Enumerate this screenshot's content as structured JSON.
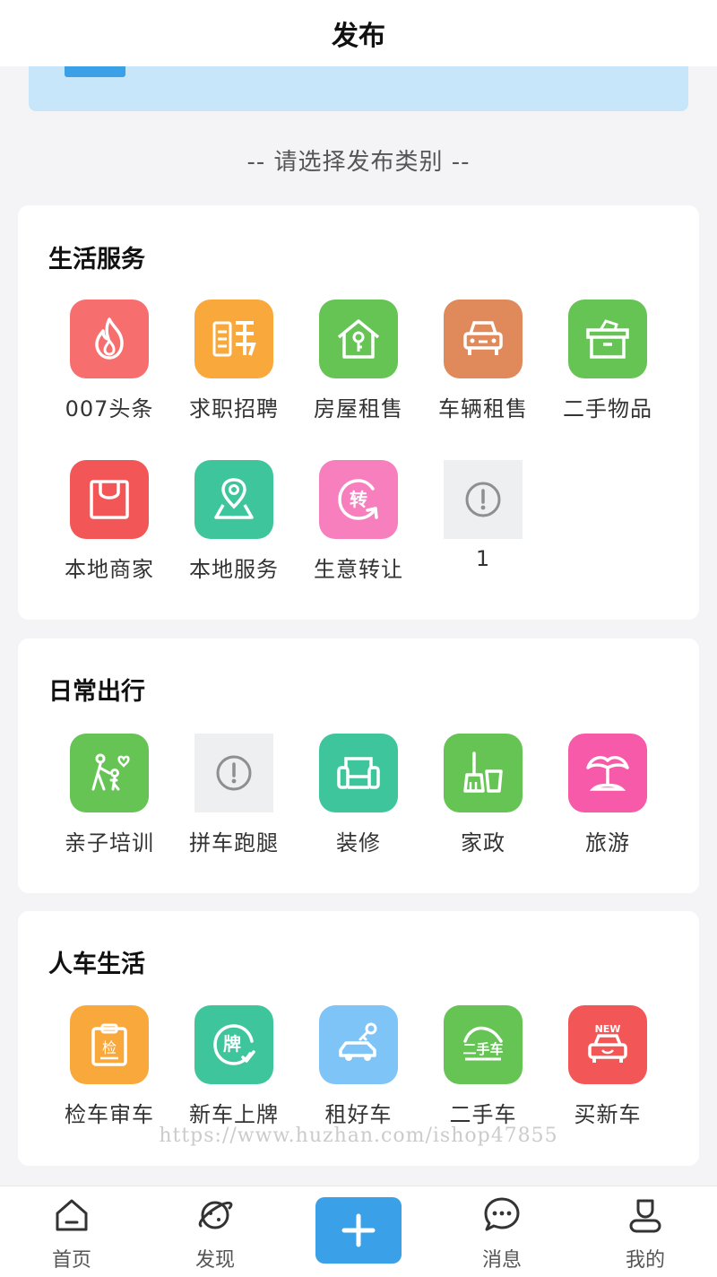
{
  "header": {
    "title": "发布"
  },
  "subtitle": "-- 请选择发布类别 --",
  "sections": [
    {
      "title": "生活服务",
      "items": [
        {
          "label": "007头条",
          "icon": "flame-icon",
          "color": "#f76e6e"
        },
        {
          "label": "求职招聘",
          "icon": "recruit-icon",
          "color": "#f9a93b"
        },
        {
          "label": "房屋租售",
          "icon": "house-key-icon",
          "color": "#66c455"
        },
        {
          "label": "车辆租售",
          "icon": "car-icon",
          "color": "#e0895a"
        },
        {
          "label": "二手物品",
          "icon": "box-icon",
          "color": "#66c455"
        },
        {
          "label": "本地商家",
          "icon": "shopping-bag-icon",
          "color": "#f35656"
        },
        {
          "label": "本地服务",
          "icon": "map-pin-icon",
          "color": "#3fc59c"
        },
        {
          "label": "生意转让",
          "icon": "transfer-icon",
          "color": "#f77fbd"
        },
        {
          "label": "1",
          "icon": "broken-image-icon",
          "color": "#eeeff1"
        }
      ]
    },
    {
      "title": "日常出行",
      "items": [
        {
          "label": "亲子培训",
          "icon": "parent-child-icon",
          "color": "#66c455"
        },
        {
          "label": "拼车跑腿",
          "icon": "broken-image-icon",
          "color": "#eeeff1"
        },
        {
          "label": "装修",
          "icon": "sofa-icon",
          "color": "#3fc59c"
        },
        {
          "label": "家政",
          "icon": "broom-icon",
          "color": "#66c455"
        },
        {
          "label": "旅游",
          "icon": "palm-tree-icon",
          "color": "#f65aa8"
        }
      ]
    },
    {
      "title": "人车生活",
      "items": [
        {
          "label": "检车审车",
          "icon": "inspection-clipboard-icon",
          "color": "#f9a93b"
        },
        {
          "label": "新车上牌",
          "icon": "license-plate-icon",
          "color": "#3fc59c"
        },
        {
          "label": "租好车",
          "icon": "car-key-icon",
          "color": "#7fc4f7"
        },
        {
          "label": "二手车",
          "icon": "used-car-icon",
          "color": "#66c455"
        },
        {
          "label": "买新车",
          "icon": "new-car-icon",
          "color": "#f35656"
        }
      ]
    }
  ],
  "watermark": "https://www.huzhan.com/ishop47855",
  "tabbar": {
    "items": [
      {
        "label": "首页",
        "icon": "home-icon"
      },
      {
        "label": "发现",
        "icon": "planet-icon"
      },
      {
        "label": "",
        "icon": "plus-icon"
      },
      {
        "label": "消息",
        "icon": "chat-bubble-icon"
      },
      {
        "label": "我的",
        "icon": "user-icon"
      }
    ]
  },
  "colors": {
    "accent": "#3aa0e8",
    "banner": "#c7e6f9",
    "background": "#f4f4f6"
  }
}
